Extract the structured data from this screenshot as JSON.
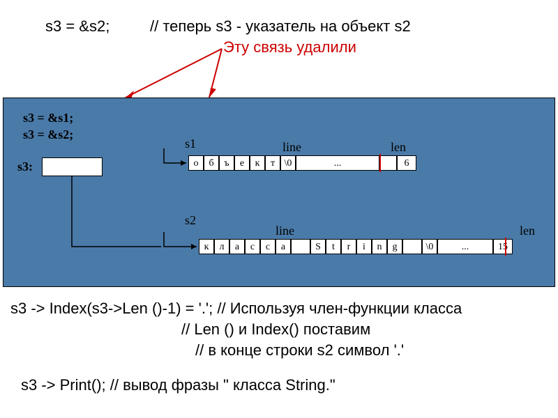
{
  "top": {
    "code1": "s3 = &s2;",
    "comment1": "// теперь s3 - указатель на объект s2",
    "deleted_label": "Эту связь удалили"
  },
  "diagram": {
    "assign1": "s3 = &s1;",
    "assign2": "s3 = &s2;",
    "s3_label": "s3:",
    "s1_label": "s1",
    "s2_label": "s2",
    "line_label1": "line",
    "len_label1": "len",
    "line_label2": "line",
    "len_label2": "len",
    "row1": [
      "о",
      "б",
      "ъ",
      "е",
      "к",
      "т",
      "\\0",
      "...",
      "",
      "6"
    ],
    "row2": [
      "к",
      "л",
      "а",
      "с",
      "с",
      "а",
      "",
      "S",
      "t",
      "r",
      "i",
      "n",
      "g",
      "",
      "\\0",
      "...",
      "15"
    ]
  },
  "bottom": {
    "line1": "s3 -> Index(s3->Len ()-1) = '.'; // Используя член-функции класса",
    "line2": "// Len () и Index() поставим",
    "line3": "// в конце строки s2  символ '.'",
    "line4": "s3 -> Print(); // вывод фразы \" класса String.\""
  }
}
